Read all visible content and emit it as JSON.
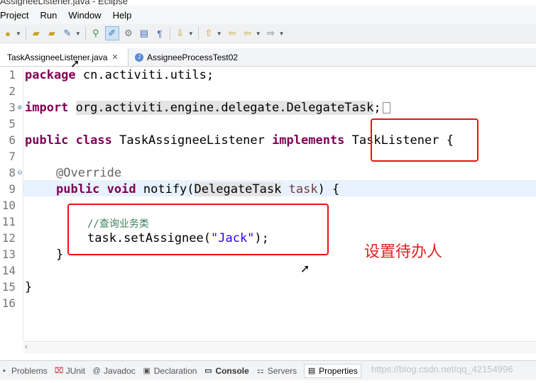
{
  "window": {
    "title": "AssigneeListener.java - Eclipse"
  },
  "menubar": {
    "items": [
      "Project",
      "Run",
      "Window",
      "Help"
    ]
  },
  "editor_tabs": [
    {
      "label": "TaskAssigneeListener.java",
      "close": "✕"
    },
    {
      "label": "AssigneeProcessTest02"
    }
  ],
  "editor": {
    "line_numbers": [
      "1",
      "2",
      "3",
      "5",
      "6",
      "7",
      "8",
      "9",
      "10",
      "11",
      "12",
      "13",
      "14",
      "15",
      "16"
    ],
    "l1_kw": "package",
    "l1_rest": " cn.activiti.utils;",
    "l3_kw": "import",
    "l3_pkg": "org.activiti.engine.delegate.DelegateTask",
    "l3_semi": ";",
    "l6_kw1": "public",
    "l6_kw2": "class",
    "l6_name": "TaskAssigneeListener",
    "l6_kw3": "implements",
    "l6_iface": "TaskListener",
    "l6_brace": "{",
    "l8_ann": "@Override",
    "l9_kw1": "public",
    "l9_kw2": "void",
    "l9_m": "notify(",
    "l9_type": "DelegateTask",
    "l9_param": "task",
    "l9_end": ") {",
    "l11_cmt": "//查询业务类",
    "l12_pre": "task.setAssignee(",
    "l12_str": "\"Jack\"",
    "l12_end": ");",
    "l13": "}",
    "l15": "}"
  },
  "annotation": {
    "text": "设置待办人"
  },
  "bottom_views": [
    {
      "label": "Problems"
    },
    {
      "label": "JUnit"
    },
    {
      "label": "Javadoc"
    },
    {
      "label": "Declaration"
    },
    {
      "label": "Console"
    },
    {
      "label": "Servers"
    },
    {
      "label": "Properties"
    }
  ],
  "watermark": "https://blog.csdn.net/qq_42154996",
  "colors": {
    "keyword": "#7f0055",
    "string": "#2a00ff",
    "comment": "#3f7f5f",
    "highlight_box": "#e11111",
    "note": "#e62020"
  }
}
